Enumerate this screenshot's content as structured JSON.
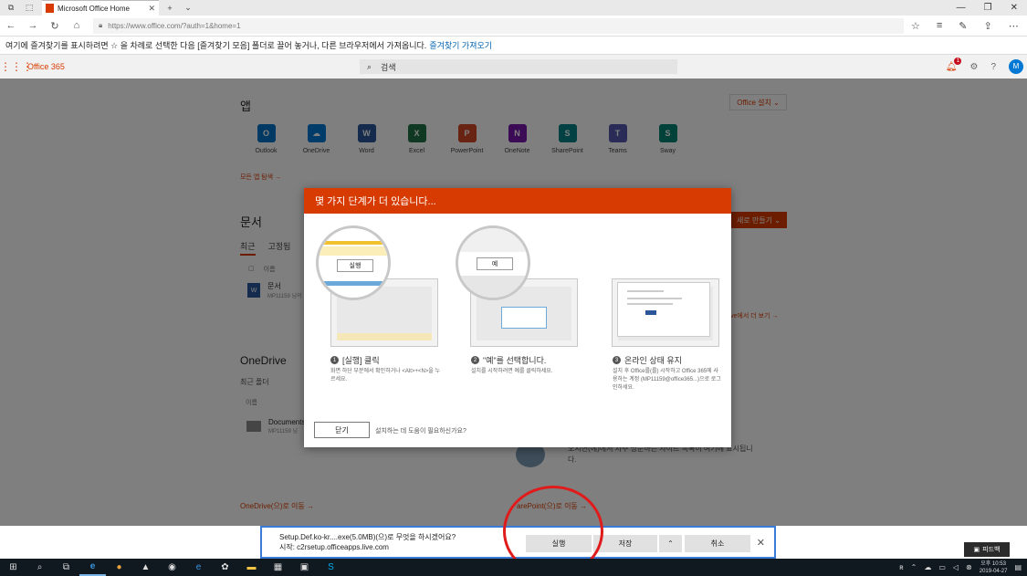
{
  "browser": {
    "tab_title": "Microsoft Office Home",
    "url": "https://www.office.com/?auth=1&home=1",
    "favorites_msg": "여기에 즐겨찾기를 표시하려면 ☆ 을 차례로 선택한 다음 [즐겨찾기 모음] 폴더로 끌어 놓거나, 다른 브라우저에서 가져옵니다.",
    "favorites_link": "즐겨찾기 가져오기"
  },
  "office": {
    "brand": "Office 365",
    "search_placeholder": "검색",
    "notif_count": "1",
    "avatar": "M"
  },
  "apps": {
    "heading": "앱",
    "install_label": "Office 설치  ⌄",
    "items": [
      {
        "name": "Outlook",
        "icon": "outlook-icon",
        "color": "#0072c6",
        "letter": "O"
      },
      {
        "name": "OneDrive",
        "icon": "onedrive-icon",
        "color": "#0078d4",
        "letter": "☁"
      },
      {
        "name": "Word",
        "icon": "word-icon",
        "color": "#2b579a",
        "letter": "W"
      },
      {
        "name": "Excel",
        "icon": "excel-icon",
        "color": "#217346",
        "letter": "X"
      },
      {
        "name": "PowerPoint",
        "icon": "powerpoint-icon",
        "color": "#d24726",
        "letter": "P"
      },
      {
        "name": "OneNote",
        "icon": "onenote-icon",
        "color": "#7719aa",
        "letter": "N"
      },
      {
        "name": "SharePoint",
        "icon": "sharepoint-icon",
        "color": "#038387",
        "letter": "S"
      },
      {
        "name": "Teams",
        "icon": "teams-icon",
        "color": "#5558af",
        "letter": "T"
      },
      {
        "name": "Sway",
        "icon": "sway-icon",
        "color": "#008272",
        "letter": "S"
      }
    ],
    "all_apps_link": "모든 앱 탐색 →"
  },
  "documents": {
    "heading": "문서",
    "tabs": [
      "최근",
      "고정됨"
    ],
    "new_button": "새로 만들기  ⌄",
    "col_name": "이름",
    "doc_name": "문서",
    "doc_meta": "MP11159 님의",
    "more_link": "ve에서 더 보기 →"
  },
  "onedrive": {
    "heading": "OneDrive",
    "subheading": "최근 폴더",
    "col_name": "이름",
    "folder_name": "Documents",
    "folder_meta": "MP11159 님",
    "link": "OneDrive(으)로 이동 →"
  },
  "sharepoint": {
    "text": "오시면(에)에서 자주 방문하는 사이트 목록이 여기에 표시됩니다.",
    "link": "arePoint(으)로 이동 →"
  },
  "dialog": {
    "title": "몇 가지 단계가 더 있습니다...",
    "steps": [
      {
        "num": "1",
        "title": "[실행] 클릭",
        "desc": "화면 하단 부분에서 확인하거나 <Alt>+<N>을 누르세요.",
        "mag_button": "실행"
      },
      {
        "num": "2",
        "title": "\"예\"를 선택합니다.",
        "desc": "설치를 시작하려면 예를 클릭하세요.",
        "mag_button": "예"
      },
      {
        "num": "3",
        "title": "온라인 상태 유지",
        "desc": "설치 후 Office를(를) 시작하고 Office 365에 사용하는 계정 (MP11159@office365...)으로 로그인하세요."
      }
    ],
    "close_button": "닫기",
    "help_text": "설치하는 데 도움이 필요하신가요?"
  },
  "download": {
    "line1": "Setup.Def.ko-kr....exe(5.0MB)(으)로 무엇을 하시겠어요?",
    "line2": "시작: c2rsetup.officeapps.live.com",
    "run": "실행",
    "save": "저장",
    "more": "⌃",
    "cancel": "취소",
    "close": "✕"
  },
  "taskbar": {
    "time": "오후 10:53",
    "date": "2019-04-27",
    "tip": "피드백"
  }
}
